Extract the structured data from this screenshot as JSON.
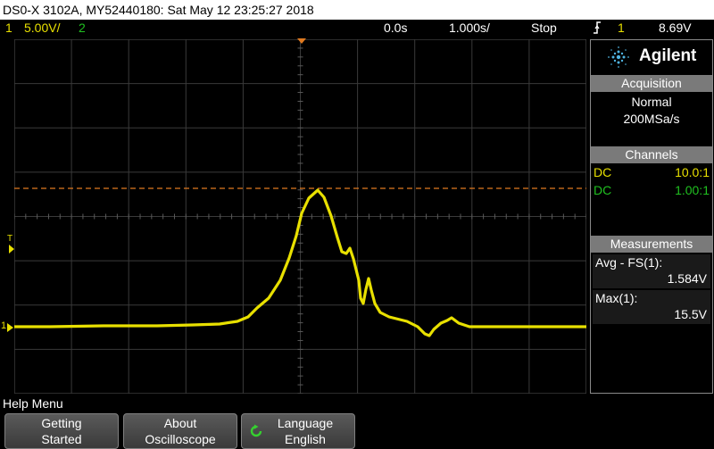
{
  "title_bar": {
    "text": "DS0-X 3102A, MY52440180: Sat May 12 23:25:27 2018"
  },
  "status_bar": {
    "ch1_number": "1",
    "ch1_scale": "5.00V/",
    "ch2_number": "2",
    "time_offset": "0.0s",
    "time_scale": "1.000s/",
    "run_state": "Stop",
    "trigger_icon": "trigger-rising-edge-icon",
    "trigger_channel": "1",
    "trigger_level": "8.69V"
  },
  "screen": {
    "trigger_marker_label": "T",
    "ch1_ground_label": "1",
    "trace_color": "#e8e000",
    "trigger_line_color": "#e07a20",
    "grid_color": "#3a3a3a"
  },
  "side_panel": {
    "brand": "Agilent",
    "acquisition": {
      "header": "Acquisition",
      "mode": "Normal",
      "rate": "200MSa/s"
    },
    "channels": {
      "header": "Channels",
      "rows": [
        {
          "coupling": "DC",
          "probe": "10.0:1",
          "color": "#e8e000"
        },
        {
          "coupling": "DC",
          "probe": "1.00:1",
          "color": "#20c020"
        }
      ]
    },
    "measurements": {
      "header": "Measurements",
      "items": [
        {
          "label": "Avg - FS(1):",
          "value": "1.584V"
        },
        {
          "label": "Max(1):",
          "value": "15.5V"
        }
      ]
    }
  },
  "help_menu": {
    "title": "Help Menu",
    "softkeys": [
      {
        "line1": "Getting",
        "line2": "Started"
      },
      {
        "line1": "About",
        "line2": "Oscilloscope"
      },
      {
        "line1": "Language",
        "line2": "English",
        "icon": "rotate-knob-icon"
      }
    ]
  }
}
